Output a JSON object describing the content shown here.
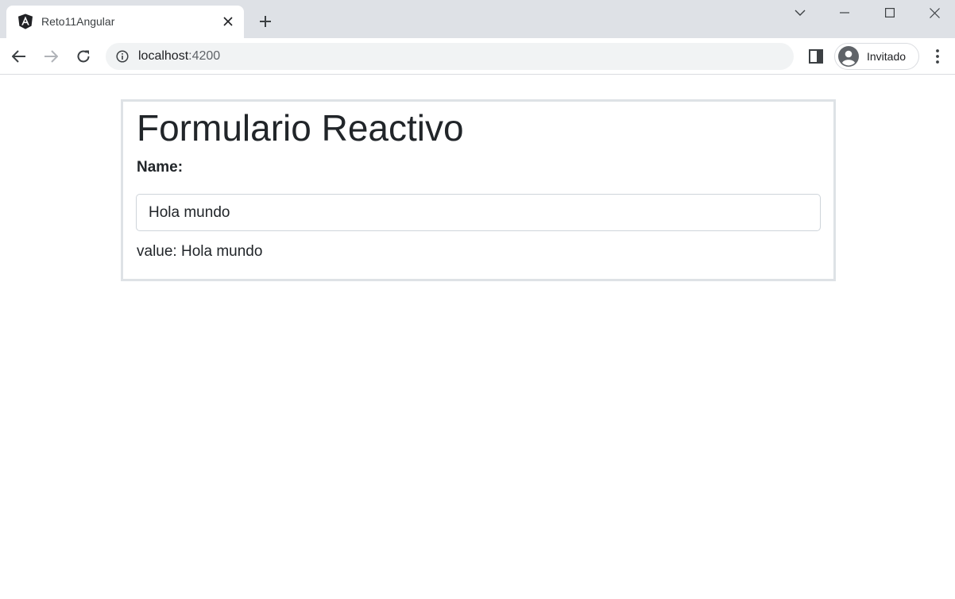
{
  "browser": {
    "tab": {
      "title": "Reto11Angular",
      "favicon": "angular-icon"
    },
    "address": {
      "host": "localhost",
      "port": ":4200"
    },
    "profile": {
      "label": "Invitado"
    }
  },
  "page": {
    "title": "Formulario Reactivo",
    "form": {
      "name_label": "Name:",
      "name_value": "Hola mundo"
    },
    "value_line": "value: Hola mundo"
  }
}
